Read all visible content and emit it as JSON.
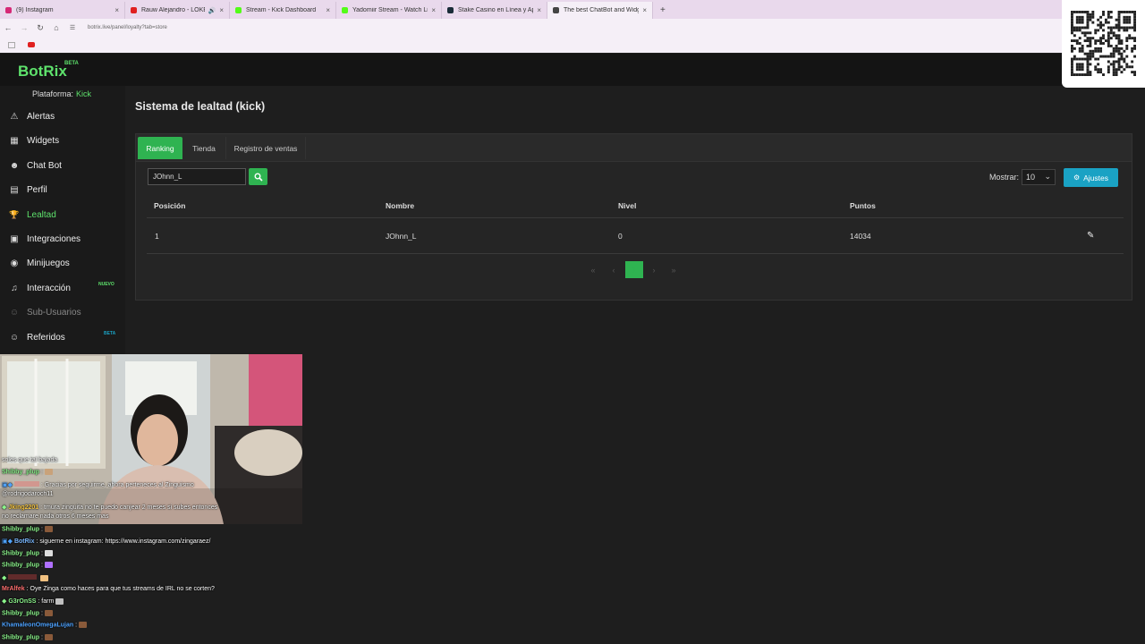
{
  "browser": {
    "tabs": [
      {
        "title": "(9) Instagram",
        "favicon_color": "#d62976"
      },
      {
        "title": "Rauw Alejandro - LOKERA (",
        "favicon_color": "#e02020",
        "audio": "🔊"
      },
      {
        "title": "Stream - Kick Dashboard",
        "favicon_color": "#53fc18"
      },
      {
        "title": "Yadomiir Stream - Watch Live o",
        "favicon_color": "#53fc18"
      },
      {
        "title": "Stake Casino en Línea y Apues",
        "favicon_color": "#1a2c38"
      },
      {
        "title": "The best ChatBot and Widgets",
        "favicon_color": "#444444"
      }
    ],
    "close_glyph": "×",
    "new_tab_glyph": "+",
    "url": "botrix.live/panel/loyalty?tab=store"
  },
  "app": {
    "logo": "BotRix",
    "logo_badge": "BETA",
    "platform_label": "Plataforma:",
    "platform_value": "Kick"
  },
  "sidebar": {
    "items": [
      {
        "label": "Alertas",
        "icon": "⚠"
      },
      {
        "label": "Widgets",
        "icon": "▦"
      },
      {
        "label": "Chat Bot",
        "icon": "☻"
      },
      {
        "label": "Perfil",
        "icon": "▤"
      },
      {
        "label": "Lealtad",
        "icon": "🏆"
      },
      {
        "label": "Integraciones",
        "icon": "▣"
      },
      {
        "label": "Minijuegos",
        "icon": "◉"
      },
      {
        "label": "Interacción",
        "icon": "♫",
        "badge": "NUEVO"
      },
      {
        "label": "Sub-Usuarios",
        "icon": "☺"
      },
      {
        "label": "Referidos",
        "icon": "☺",
        "badge": "BETA"
      }
    ]
  },
  "main": {
    "title": "Sistema de lealtad (kick)",
    "tabs": [
      "Ranking",
      "Tienda",
      "Registro de ventas"
    ],
    "search_value": "JOhnn_L",
    "show_label": "Mostrar:",
    "show_value": "10",
    "settings_label": "Ajustes",
    "table": {
      "headers": [
        "Posición",
        "Nombre",
        "Nivel",
        "Puntos"
      ],
      "rows": [
        [
          "1",
          "JOhnn_L",
          "0",
          "14034"
        ]
      ]
    },
    "pagination": {
      "first": "«",
      "prev": "‹",
      "current": "1",
      "next": "›",
      "last": "»"
    }
  },
  "chat": [
    {
      "user": "",
      "text": "soles que tal bajada",
      "user_color": "#ffffff"
    },
    {
      "user": "Shibby_plup",
      "text": ":",
      "user_color": "#8cf58c",
      "emote": "#c9a27a"
    },
    {
      "user": "",
      "text": ": Gracias por seguirme, ahora perteneces al Zinguismo",
      "user_color": "#ff4d4d"
    },
    {
      "user": "",
      "text": "@rodrigodaroch11",
      "user_color": "#ffffff"
    },
    {
      "user": "Jking2201",
      "text": ": tmura zinguita no te puedo canjear 2 meses si subes entonces",
      "user_color": "#f5c542"
    },
    {
      "user": "",
      "text": "no reclamare nada otros 6 meses mas",
      "user_color": "#ffffff"
    },
    {
      "user": "Shibby_plup",
      "text": ":",
      "user_color": "#8cf58c",
      "emote": "#8a5a3a"
    },
    {
      "user": "BotRix",
      "text": ": siguerne en instagram: https://www.instagram.com/zingaraez/",
      "user_color": "#7ab8ff"
    },
    {
      "user": "Shibby_plup",
      "text": ":",
      "user_color": "#8cf58c",
      "emote": "#dddddd"
    },
    {
      "user": "Shibby_plup",
      "text": ":",
      "user_color": "#8cf58c",
      "emote": "#b070ff"
    },
    {
      "user": "",
      "text": "",
      "user_color": "#ff4d4d",
      "emote": "#f0c080"
    },
    {
      "user": "MrAlfek",
      "text": ": Oye Zinga como haces para que tus streams de IRL no se corten?",
      "user_color": "#ff7070"
    },
    {
      "user": "G3rOnSS",
      "text": ": farm",
      "user_color": "#8cf58c",
      "emote": "#c0c0c0"
    },
    {
      "user": "Shibby_plup",
      "text": ":",
      "user_color": "#8cf58c",
      "emote": "#8a5a3a"
    },
    {
      "user": "KhamaleonOmegaLujan",
      "text": ":",
      "user_color": "#4fa3ff",
      "emote": "#8a5a3a"
    },
    {
      "user": "Shibby_plup",
      "text": ":",
      "user_color": "#8cf58c",
      "emote": "#8a5a3a"
    }
  ],
  "colors": {
    "accent": "#2fb351",
    "brand": "#5ee26c",
    "info": "#1aa2c4",
    "background": "#1e1e1e"
  }
}
